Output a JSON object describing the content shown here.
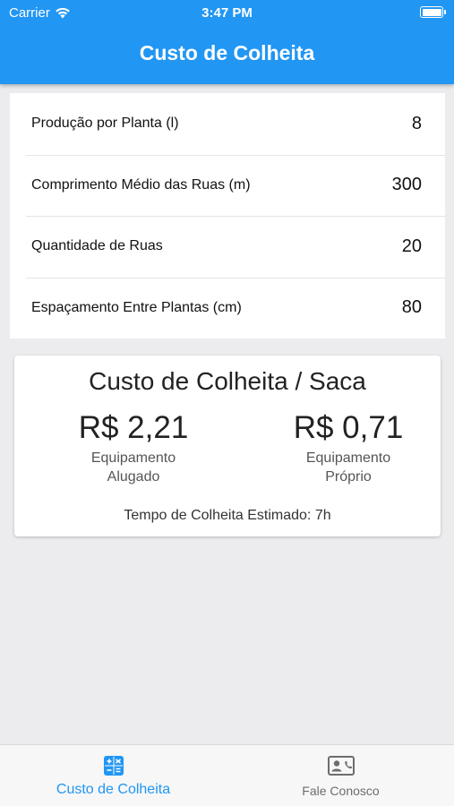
{
  "status_bar": {
    "carrier": "Carrier",
    "time": "3:47 PM"
  },
  "header": {
    "title": "Custo de Colheita"
  },
  "form": {
    "rows": [
      {
        "label": "Produção por Planta (l)",
        "value": "8"
      },
      {
        "label": "Comprimento Médio das Ruas (m)",
        "value": "300"
      },
      {
        "label": "Quantidade de Ruas",
        "value": "20"
      },
      {
        "label": "Espaçamento Entre Plantas (cm)",
        "value": "80"
      }
    ]
  },
  "result": {
    "title": "Custo de Colheita / Saca",
    "rented": {
      "price": "R$ 2,21",
      "line1": "Equipamento",
      "line2": "Alugado"
    },
    "owned": {
      "price": "R$ 0,71",
      "line1": "Equipamento",
      "line2": "Próprio"
    },
    "estimate": "Tempo de Colheita Estimado: 7h"
  },
  "tabs": [
    {
      "label": "Custo de Colheita",
      "icon": "calculator-icon",
      "active": true
    },
    {
      "label": "Fale Conosco",
      "icon": "contact-card-icon",
      "active": false
    }
  ],
  "colors": {
    "primary": "#2196f3",
    "background": "#ececee",
    "tab_inactive": "#6d6d6d"
  }
}
